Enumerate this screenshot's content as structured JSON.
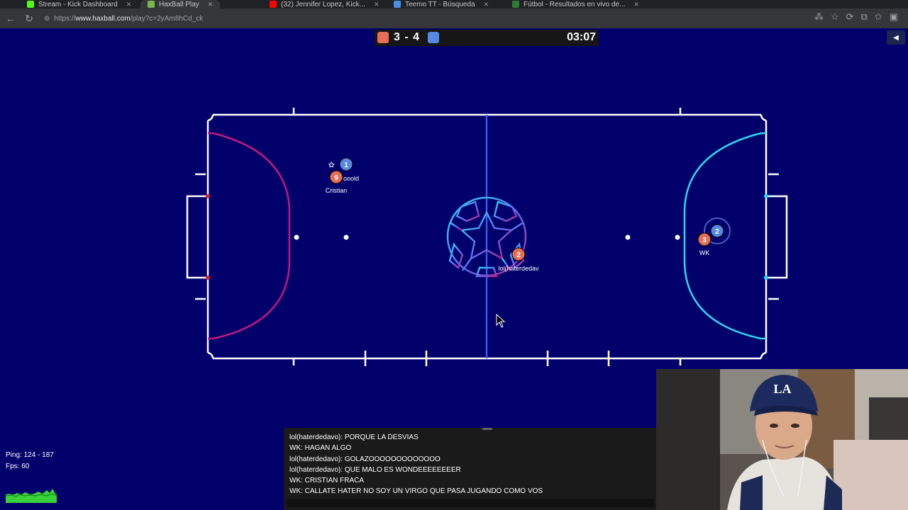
{
  "browser": {
    "tabs": [
      {
        "label": "Stream - Kick Dashboard",
        "icon_color": "#53fc18"
      },
      {
        "label": "HaxBall Play",
        "icon_color": "#7ab648"
      },
      {
        "label": "(32) Jennifer Lopez, Kick...",
        "icon_color": "#ff0000"
      },
      {
        "label": "Teemo TT - Búsqueda",
        "icon_color": "#4a90e2"
      },
      {
        "label": "Fútbol - Resultados en vivo de...",
        "icon_color": "#2e7d32"
      }
    ],
    "url_scheme": "https://",
    "url_domain": "www.haxball.com",
    "url_path": "/play?c=2yAm8hCd_ck"
  },
  "scoreboard": {
    "score": "3 - 4",
    "time": "03:07",
    "red_color": "#e56e56",
    "blue_color": "#5689e5"
  },
  "players": [
    {
      "number": "1",
      "team": "blue",
      "name": "",
      "has_star": true
    },
    {
      "number": "9",
      "team": "red",
      "name": "Cristian",
      "partial_name": "ooold"
    },
    {
      "number": "2",
      "team": "red",
      "name": "lol(haterdedav"
    },
    {
      "number": "2",
      "team": "blue",
      "name": ""
    },
    {
      "number": "3",
      "team": "red",
      "name": "WK"
    }
  ],
  "chat": {
    "messages": [
      "lol(haterdedavo): PORQUE LA DESVIAS",
      "WK: HAGAN ALGO",
      "lol(haterdedavo): GOLAZOOOOOOOOOOOOO",
      "lol(haterdedavo): QUE MALO ES WONDEEEEEEEER",
      "WK: CRISTIAN FRACA",
      "WK: CALLATE HATER NO SOY UN VIRGO QUE PASA JUGANDO COMO VOS"
    ]
  },
  "stats": {
    "ping": "Ping: 124 - 187",
    "fps": "Fps: 60"
  },
  "field_colors": {
    "background": "#02006b",
    "red_area": "#c0197d",
    "blue_area": "#2ad8ee",
    "midline": "#2b62f0",
    "lines": "#ffffff"
  }
}
